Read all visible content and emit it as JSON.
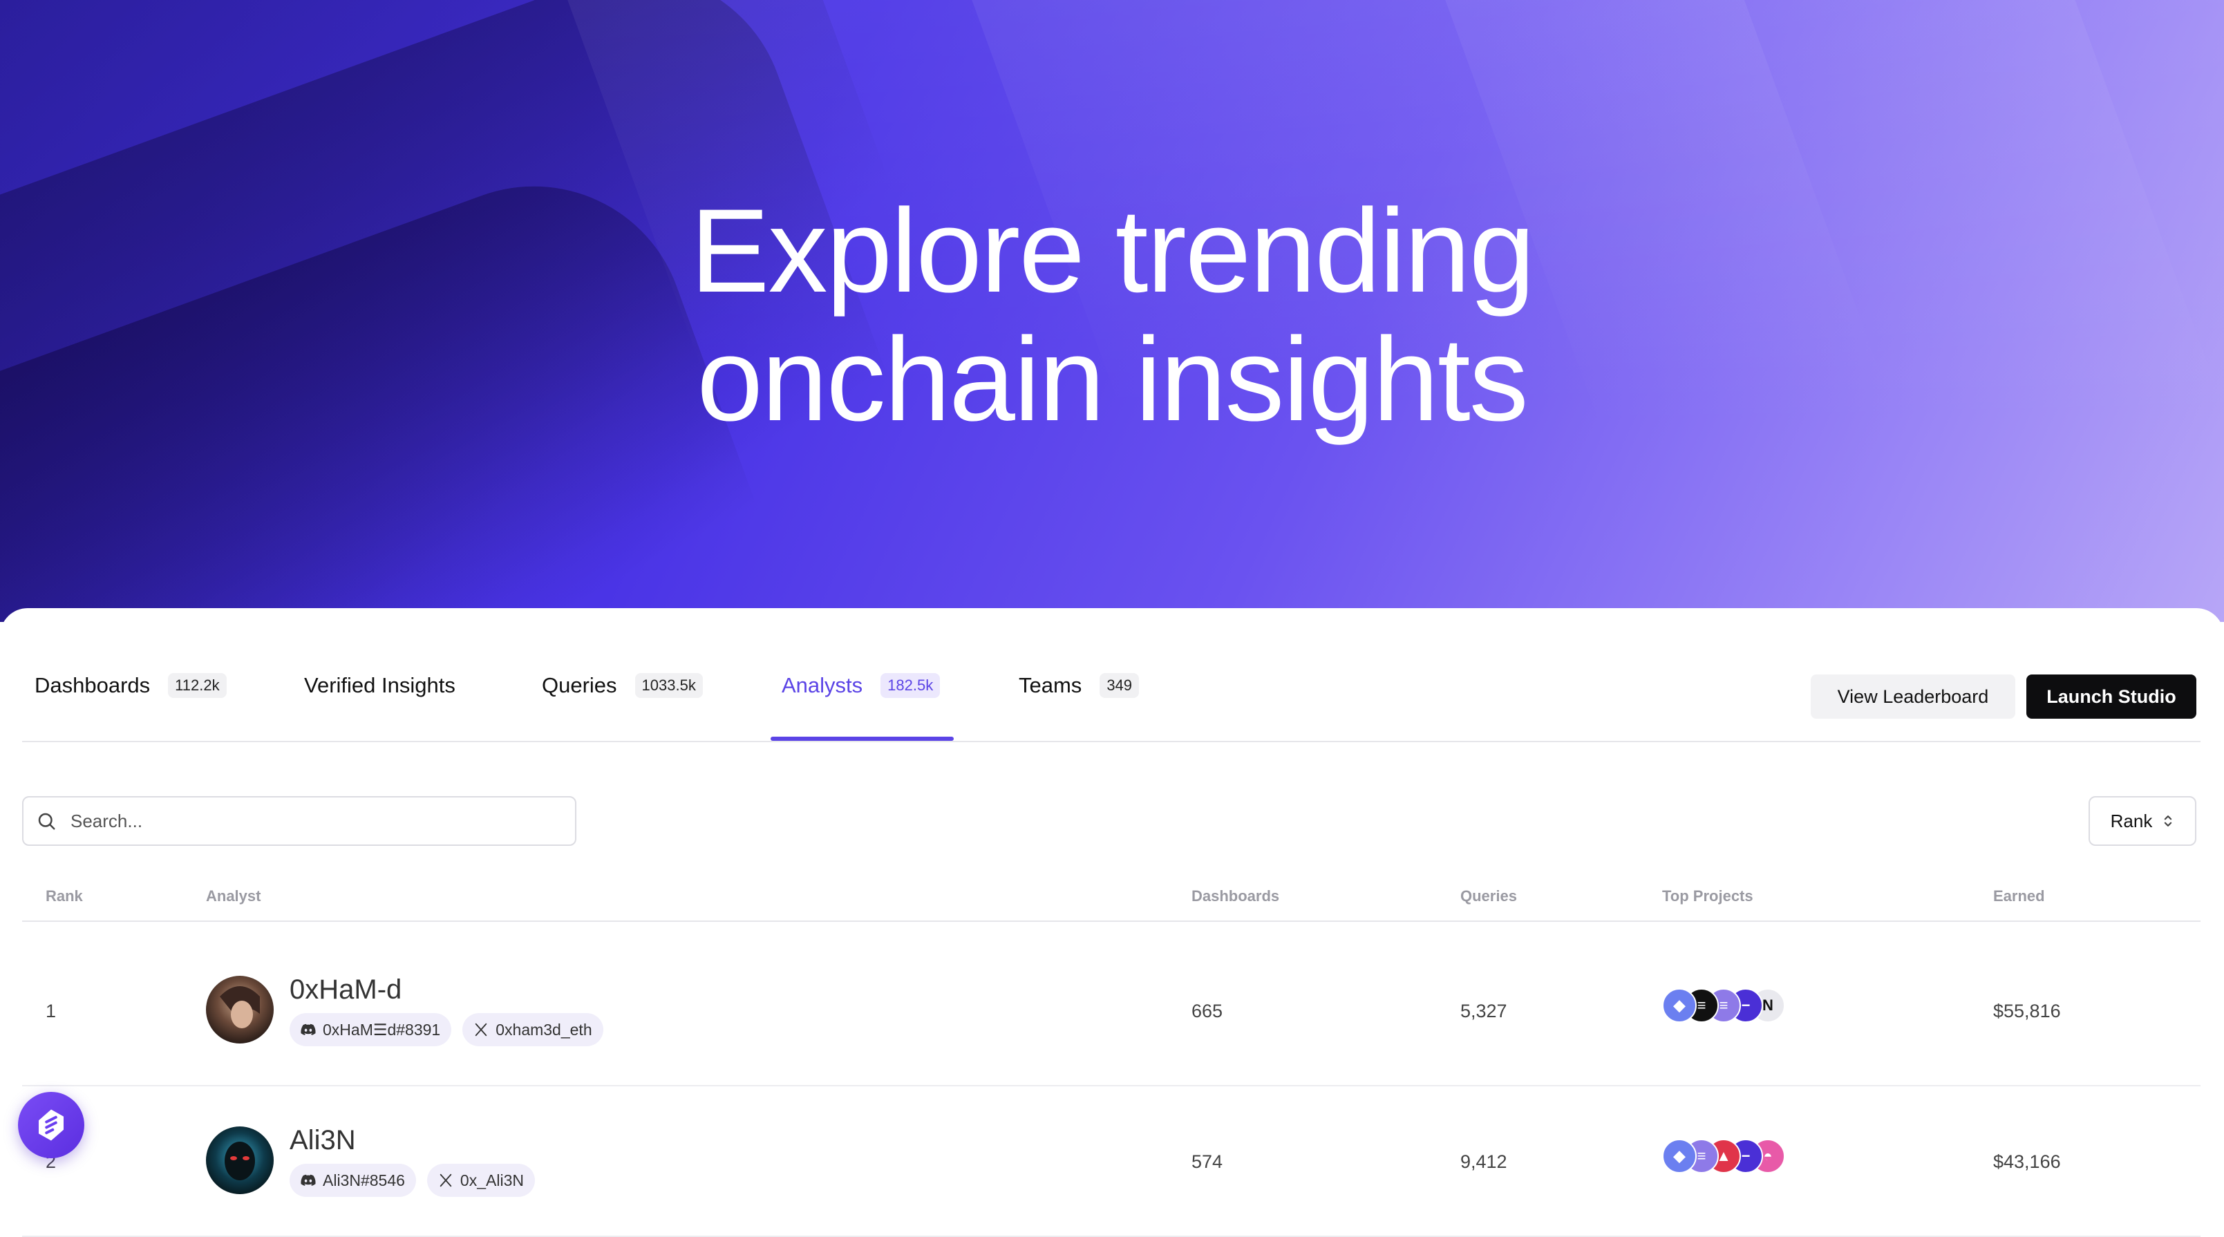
{
  "hero": {
    "title_line1": "Explore trending",
    "title_line2": "onchain insights"
  },
  "tabs": [
    {
      "label": "Dashboards",
      "count": "112.2k"
    },
    {
      "label": "Verified Insights",
      "count": ""
    },
    {
      "label": "Queries",
      "count": "1033.5k"
    },
    {
      "label": "Analysts",
      "count": "182.5k",
      "active": true
    },
    {
      "label": "Teams",
      "count": "349"
    }
  ],
  "actions": {
    "view_leaderboard": "View Leaderboard",
    "launch_studio": "Launch Studio"
  },
  "search": {
    "placeholder": "Search..."
  },
  "sort": {
    "label": "Rank"
  },
  "table": {
    "headers": {
      "rank": "Rank",
      "analyst": "Analyst",
      "dashboards": "Dashboards",
      "queries": "Queries",
      "top_projects": "Top Projects",
      "earned": "Earned"
    },
    "rows": [
      {
        "rank": "1",
        "name": "0xHaM-d",
        "discord": "0xHaM☰d#8391",
        "x_handle": "0xham3d_eth",
        "dashboards": "665",
        "queries": "5,327",
        "earned": "$55,816",
        "projects": [
          "ethereum-icon",
          "ethena-icon",
          "solana-icon",
          "base-icon",
          "near-icon"
        ]
      },
      {
        "rank": "2",
        "name": "Ali3N",
        "discord": "Ali3N#8546",
        "x_handle": "0x_Ali3N",
        "dashboards": "574",
        "queries": "9,412",
        "earned": "$43,166",
        "projects": [
          "ethereum-icon",
          "solana-icon",
          "avalanche-icon",
          "base-icon",
          "blast-icon"
        ]
      }
    ]
  },
  "colors": {
    "accent": "#5b44e6",
    "primary_button": "#0d0d0f",
    "hero_start": "#3b2bd6",
    "hero_end": "#b7a6f7"
  }
}
